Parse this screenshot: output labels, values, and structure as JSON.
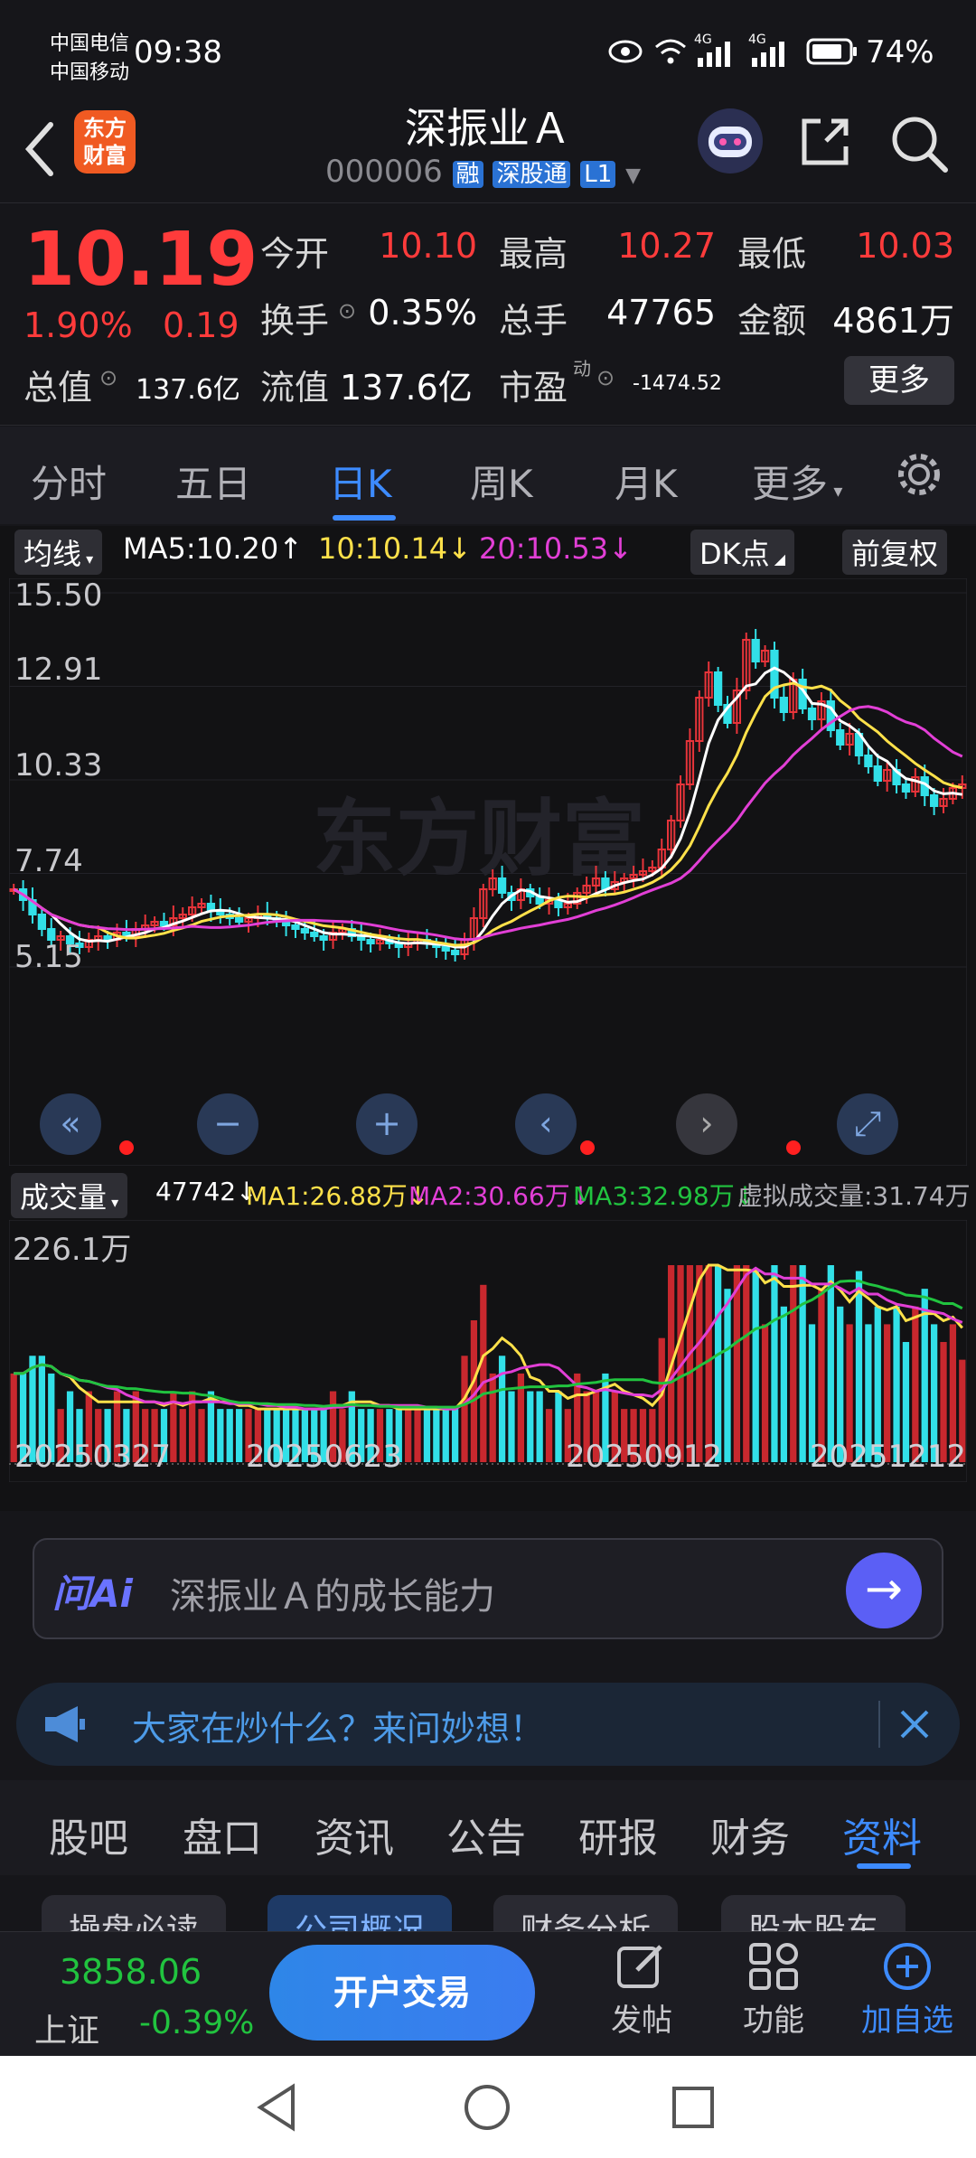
{
  "status_bar": {
    "carrier1": "中国电信",
    "carrier2": "中国移动",
    "time": "09:38",
    "battery": "74%",
    "net1": "4G",
    "net2": "4G"
  },
  "header": {
    "title": "深振业Ａ",
    "code": "000006",
    "tag1": "融",
    "tag2": "深股通",
    "tag3": "L1",
    "logo_line1": "东方",
    "logo_line2": "财富"
  },
  "quote": {
    "price": "10.19",
    "change_pct": "1.90%",
    "change": "0.19",
    "open_label": "今开",
    "open": "10.10",
    "high_label": "最高",
    "high": "10.27",
    "low_label": "最低",
    "low": "10.03",
    "turnover_label": "换手",
    "turnover": "0.35%",
    "volume_label": "总手",
    "volume": "47765",
    "amount_label": "金额",
    "amount": "4861万",
    "mktcap_label": "总值",
    "mktcap": "137.6亿",
    "float_label": "流值",
    "float": "137.6亿",
    "pe_label": "市盈",
    "pe_sup": "动",
    "pe": "-1474.52",
    "more_label": "更多"
  },
  "tabs": [
    "分时",
    "五日",
    "日K",
    "周K",
    "月K",
    "更多"
  ],
  "active_tab": 2,
  "ma_bar": {
    "selector": "均线",
    "ma5": "MA5:10.20↑",
    "ma10": "10:10.14↓",
    "ma20": "20:10.53↓",
    "dk": "DK点",
    "adj": "前复权",
    "ma10_color": "#ffe14a",
    "ma20_color": "#e23fd6"
  },
  "watermark": "东方财富",
  "price_axis": [
    "15.50",
    "12.91",
    "10.33",
    "7.74",
    "5.15"
  ],
  "vol_bar": {
    "selector": "成交量",
    "vol": "47742↓",
    "ma1": "MA1:26.88万↓",
    "ma2": "MA2:30.66万↓",
    "ma3": "MA3:32.98万↓",
    "virtual": "虚拟成交量:31.74万"
  },
  "vol_axis_top": "226.1万",
  "date_labels": [
    "20250327",
    "20250623",
    "20250912",
    "20251212"
  ],
  "chart_data": {
    "type": "candlestick",
    "ylim": [
      5.15,
      15.5
    ],
    "closes": [
      7.3,
      7.0,
      6.6,
      6.2,
      5.9,
      6.0,
      5.8,
      5.7,
      5.9,
      6.0,
      5.9,
      6.1,
      6.0,
      6.2,
      6.3,
      6.4,
      6.3,
      6.5,
      6.6,
      6.8,
      6.9,
      6.7,
      6.6,
      6.5,
      6.4,
      6.5,
      6.6,
      6.5,
      6.4,
      6.3,
      6.2,
      6.1,
      6.0,
      5.9,
      6.1,
      6.2,
      6.0,
      5.9,
      5.8,
      5.9,
      5.8,
      5.7,
      5.8,
      5.9,
      5.8,
      5.7,
      5.6,
      5.5,
      5.9,
      6.5,
      7.3,
      7.6,
      7.2,
      7.0,
      7.3,
      7.1,
      6.9,
      7.0,
      6.8,
      6.9,
      7.2,
      7.4,
      7.6,
      7.3,
      7.5,
      7.6,
      7.7,
      7.8,
      7.9,
      8.4,
      9.2,
      10.2,
      11.4,
      12.6,
      13.3,
      12.4,
      11.9,
      12.8,
      14.2,
      13.6,
      13.9,
      12.6,
      12.2,
      13.1,
      12.3,
      12.0,
      12.5,
      11.7,
      11.3,
      11.6,
      11.0,
      10.7,
      10.3,
      10.6,
      10.2,
      10.0,
      10.4,
      9.9,
      9.6,
      9.8,
      10.1,
      10.2
    ],
    "volume_max_label": "226.1万"
  },
  "ai": {
    "label": "问Ai",
    "placeholder": "深振业Ａ的成长能力"
  },
  "notice": {
    "text": "大家在炒什么？来问妙想！"
  },
  "sub_tabs": [
    "股吧",
    "盘口",
    "资讯",
    "公告",
    "研报",
    "财务",
    "资料"
  ],
  "active_sub_tab": 6,
  "chips": [
    "操盘必读",
    "公司概况",
    "财务分析",
    "股本股东"
  ],
  "bottom_nav": {
    "index_value": "3858.06",
    "index_name": "上证",
    "index_change": "-0.39%",
    "trade_button": "开户交易",
    "post": "发帖",
    "func": "功能",
    "add": "加自选"
  }
}
